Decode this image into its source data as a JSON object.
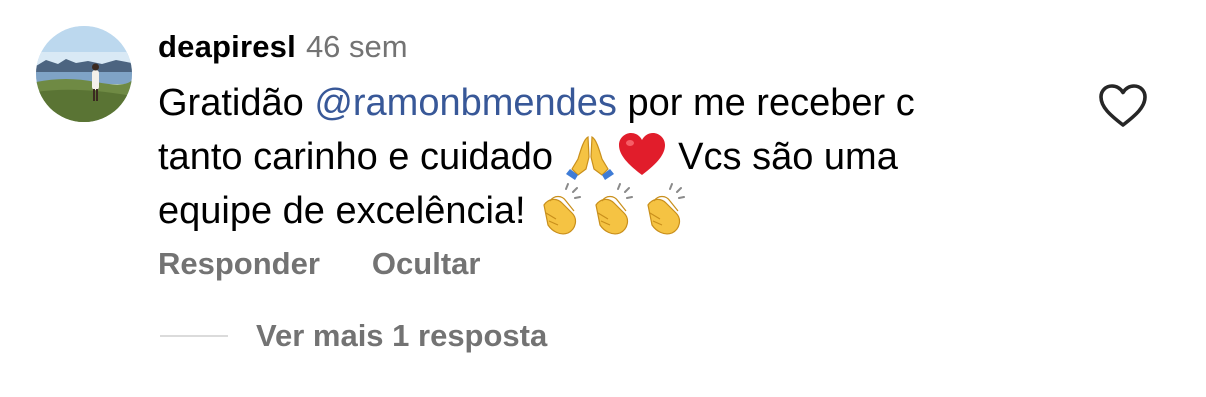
{
  "comment": {
    "username": "deapiresl",
    "time": "46 sem",
    "text_part1": "Gratidão ",
    "mention": "@ramonbmendes",
    "text_part2": " por me receber c",
    "text_line2": "tanto carinho e cuidado ",
    "emoji_pray": "praying-hands-emoji",
    "emoji_heart": "red-heart-emoji",
    "text_line2_end": " Vcs são uma",
    "text_line3": "equipe de excelência! ",
    "emoji_clap": "clapping-hands-emoji",
    "like_icon": "heart-outline-icon"
  },
  "actions": {
    "reply_label": "Responder",
    "hide_label": "Ocultar"
  },
  "replies": {
    "view_more_label": "Ver mais 1 resposta"
  },
  "colors": {
    "mention": "#385898",
    "secondary_text": "#737373",
    "divider": "#dbdbdb"
  }
}
